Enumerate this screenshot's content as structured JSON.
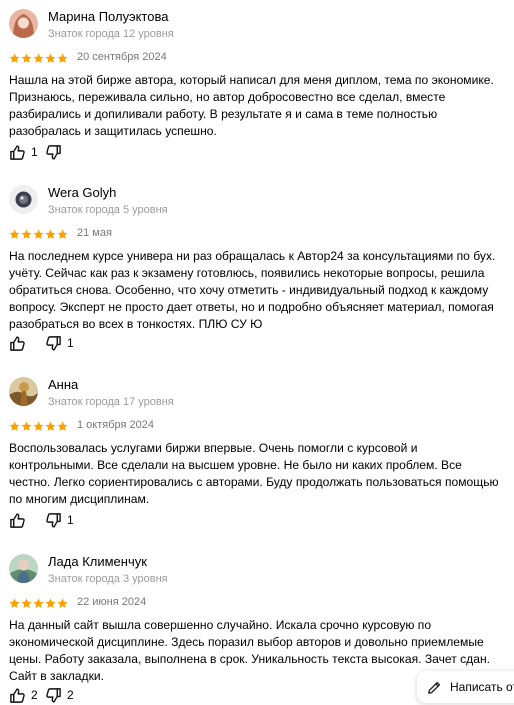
{
  "reviews": [
    {
      "author": "Марина Полуэктова",
      "level": "Знаток города 12 уровня",
      "rating": 5,
      "date": "20 сентября 2024",
      "text": "Нашла на этой бирже автора, который написал для меня диплом, тема по экономике. Признаюсь, переживала сильно, но автор добросовестно все сделал, вместе разбирались и допиливали работу. В результате я и сама в теме полностью разобралась и защитилась успешно.",
      "likes": "1",
      "dislikes": ""
    },
    {
      "author": "Wera Golyh",
      "level": "Знаток города 5 уровня",
      "rating": 5,
      "date": "21 мая",
      "text": "На последнем курсе универа ни раз обращалась к Автор24 за консультациями по бух. учёту. Сейчас как раз к экзамену готовлюсь, появились некоторые вопросы, решила обратиться снова. Особенно, что хочу отметить - индивидуальный подход к каждому вопросу. Эксперт не просто дает ответы, но и подробно объясняет материал, помогая разобраться во всех в тонкостях. ПЛЮ СУ Ю",
      "likes": "",
      "dislikes": "1"
    },
    {
      "author": "Анна",
      "level": "Знаток города 17 уровня",
      "rating": 5,
      "date": "1 октября 2024",
      "text": "Воспользовалась услугами биржи впервые. Очень помогли с курсовой и контрольными. Все сделали на высшем уровне. Не было ни каких проблем. Все честно. Легко сориентировались с авторами. Буду продолжать пользоваться помощью по многим дисциплинам.",
      "likes": "",
      "dislikes": "1"
    },
    {
      "author": "Лада Клименчук",
      "level": "Знаток города 3 уровня",
      "rating": 5,
      "date": "22 июня 2024",
      "text": "На данный сайт вышла совершенно случайно. Искала срочно курсовую по экономической дисциплине. Здесь поразил выбор авторов и довольно приемлемые цены. Работу заказала, выполнена в срок. Уникальность текста высокая. Зачет сдан. Сайт в закладки.",
      "likes": "2",
      "dislikes": "2"
    }
  ],
  "write_review_label": "Написать отз",
  "colors": {
    "star": "#fc9e00",
    "accent_text": "#9c9c9c"
  },
  "icons": [
    "thumbs-up-icon",
    "thumbs-down-icon",
    "star-icon",
    "pencil-icon"
  ]
}
